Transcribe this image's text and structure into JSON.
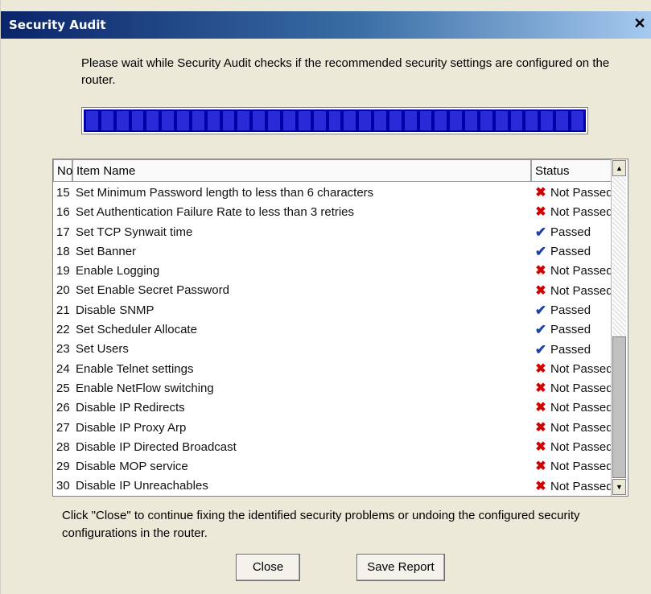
{
  "window": {
    "title": "Security Audit",
    "close_glyph": "✕"
  },
  "intro": "Please wait while Security Audit checks if the recommended security settings are configured on the router.",
  "progress": {
    "fill_fraction": 1.0,
    "segments": 33,
    "color": "#0000a8"
  },
  "table": {
    "headers": {
      "no": "No",
      "item": "Item Name",
      "status": "Status"
    },
    "rows": [
      {
        "no": "15",
        "name": "Set Minimum Password length to less than 6 characters",
        "status": "Not Passed",
        "passed": false
      },
      {
        "no": "16",
        "name": "Set Authentication Failure Rate to less than 3 retries",
        "status": "Not Passed",
        "passed": false
      },
      {
        "no": "17",
        "name": "Set TCP Synwait time",
        "status": "Passed",
        "passed": true
      },
      {
        "no": "18",
        "name": "Set Banner",
        "status": "Passed",
        "passed": true
      },
      {
        "no": "19",
        "name": "Enable Logging",
        "status": "Not Passed",
        "passed": false
      },
      {
        "no": "20",
        "name": "Set Enable Secret Password",
        "status": "Not Passed",
        "passed": false
      },
      {
        "no": "21",
        "name": "Disable SNMP",
        "status": "Passed",
        "passed": true
      },
      {
        "no": "22",
        "name": "Set Scheduler Allocate",
        "status": "Passed",
        "passed": true
      },
      {
        "no": "23",
        "name": "Set Users",
        "status": "Passed",
        "passed": true
      },
      {
        "no": "24",
        "name": "Enable Telnet settings",
        "status": "Not Passed",
        "passed": false
      },
      {
        "no": "25",
        "name": "Enable NetFlow switching",
        "status": "Not Passed",
        "passed": false
      },
      {
        "no": "26",
        "name": "Disable IP Redirects",
        "status": "Not Passed",
        "passed": false
      },
      {
        "no": "27",
        "name": "Disable IP Proxy Arp",
        "status": "Not Passed",
        "passed": false
      },
      {
        "no": "28",
        "name": "Disable IP Directed Broadcast",
        "status": "Not Passed",
        "passed": false
      },
      {
        "no": "29",
        "name": "Disable MOP service",
        "status": "Not Passed",
        "passed": false
      },
      {
        "no": "30",
        "name": "Disable IP Unreachables",
        "status": "Not Passed",
        "passed": false
      }
    ]
  },
  "icons": {
    "pass": "✔",
    "fail": "✖",
    "pass_color": "#1c3fa8",
    "fail_color": "#d40000"
  },
  "footer": "Click \"Close\" to continue fixing the identified security problems or undoing the configured security configurations in the router.",
  "buttons": {
    "close": "Close",
    "save": "Save Report"
  }
}
